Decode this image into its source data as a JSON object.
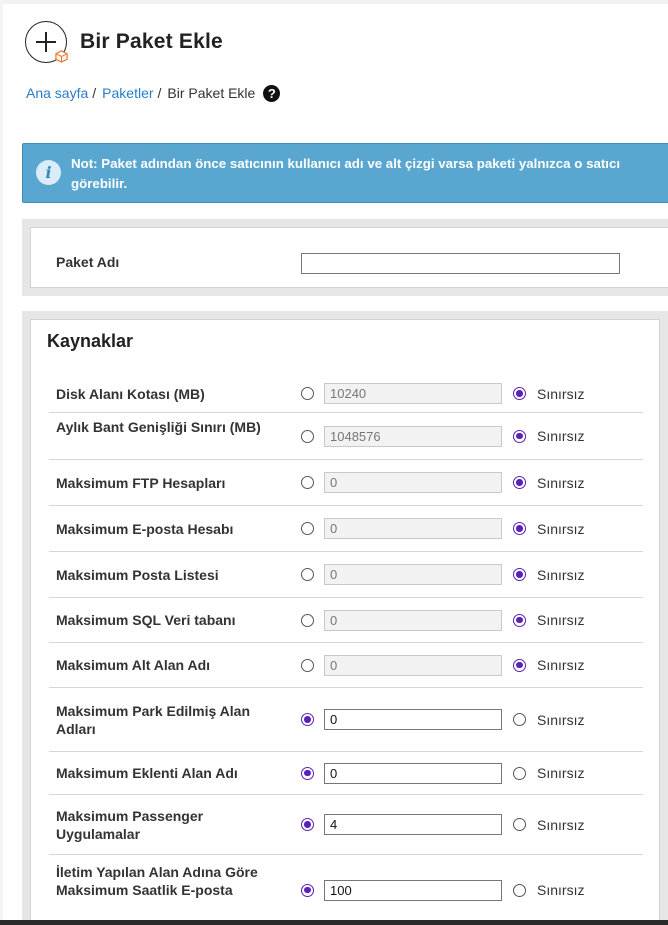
{
  "header": {
    "title": "Bir Paket Ekle"
  },
  "breadcrumb": {
    "home": "Ana sayfa",
    "packages": "Paketler",
    "current": "Bir Paket Ekle",
    "separator": "/"
  },
  "note": {
    "prefix": "Not:",
    "text": "Paket adından önce satıcının kullanıcı adı ve alt çizgi varsa paketi yalnızca o satıcı görebilir."
  },
  "package_name": {
    "label": "Paket Adı",
    "value": ""
  },
  "resources": {
    "title": "Kaynaklar",
    "unlimited_label": "Sınırsız",
    "rows": [
      {
        "label": "Disk Alanı Kotası (MB)",
        "value": "10240",
        "unlimited": true
      },
      {
        "label": "Aylık Bant Genişliği Sınırı (MB)",
        "value": "1048576",
        "unlimited": true
      },
      {
        "label": "Maksimum FTP Hesapları",
        "value": "0",
        "unlimited": true
      },
      {
        "label": "Maksimum E-posta Hesabı",
        "value": "0",
        "unlimited": true
      },
      {
        "label": "Maksimum Posta Listesi",
        "value": "0",
        "unlimited": true
      },
      {
        "label": "Maksimum SQL Veri tabanı",
        "value": "0",
        "unlimited": true
      },
      {
        "label": "Maksimum Alt Alan Adı",
        "value": "0",
        "unlimited": true
      },
      {
        "label": "Maksimum Park Edilmiş Alan Adları",
        "value": "0",
        "unlimited": false
      },
      {
        "label": "Maksimum Eklenti Alan Adı",
        "value": "0",
        "unlimited": false
      },
      {
        "label": "Maksimum Passenger Uygulamalar",
        "value": "4",
        "unlimited": false
      },
      {
        "label": "İletim Yapılan Alan Adına Göre Maksimum Saatlik E-posta",
        "value": "100",
        "unlimited": false
      }
    ]
  },
  "colors": {
    "link": "#2a7cc7",
    "alert_bg": "#59a7d1",
    "radio_checked": "#5b21b6"
  }
}
